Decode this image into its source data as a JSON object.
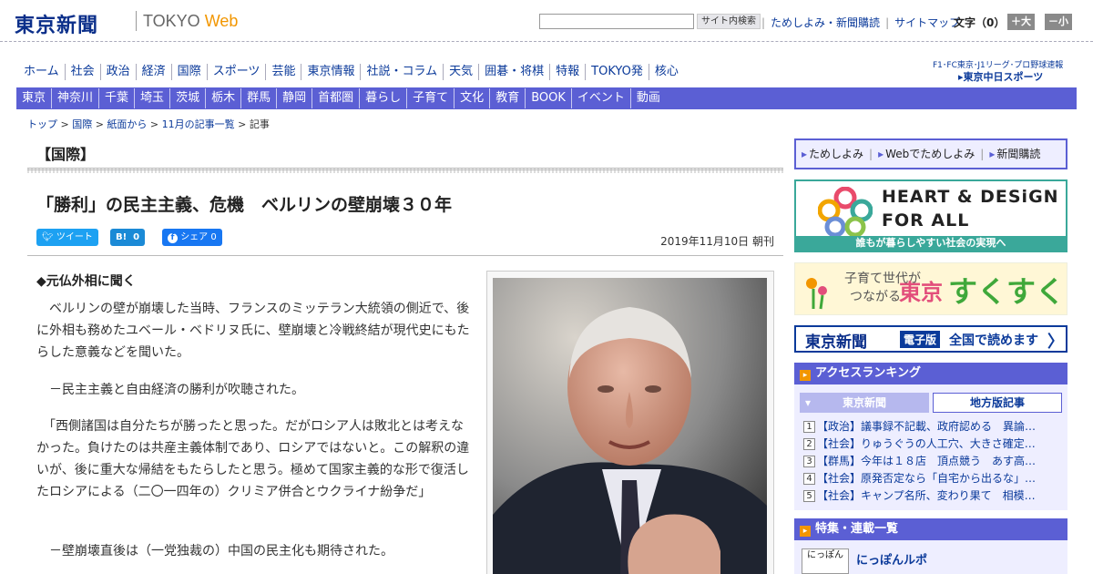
{
  "header": {
    "logo": "東京新聞",
    "logo_sub_a": "TOKYO",
    "logo_sub_b": "Web",
    "search_placeholder": "",
    "search_button": "サイト内検索",
    "links": [
      "ためしよみ・新聞購読",
      "サイトマップ"
    ],
    "font_size_label": "文字（0）",
    "font_up": "＋大",
    "font_down": "－小"
  },
  "nav_main": [
    "ホーム",
    "社会",
    "政治",
    "経済",
    "国際",
    "スポーツ",
    "芸能",
    "東京情報",
    "社説・コラム",
    "天気",
    "囲碁・将棋",
    "特報",
    "TOKYO発",
    "核心"
  ],
  "sports": {
    "line1": "F1･FC東京･J1リーグ･プロ野球速報",
    "line2": "▸東京中日スポーツ"
  },
  "nav_region": [
    "東京",
    "神奈川",
    "千葉",
    "埼玉",
    "茨城",
    "栃木",
    "群馬",
    "静岡",
    "首都圏",
    "暮らし",
    "子育て",
    "文化",
    "教育",
    "BOOK",
    "イベント",
    "動画"
  ],
  "breadcrumb": [
    "トップ",
    "国際",
    "紙面から",
    "11月の記事一覧",
    "記事"
  ],
  "article": {
    "section": "【国際】",
    "headline": "「勝利」の民主主義、危機　ベルリンの壁崩壊３０年",
    "share": {
      "tweet": "ツイート",
      "hatena": "B!",
      "hatena_count": "0",
      "fb": "シェア",
      "fb_count": "0"
    },
    "date": "2019年11月10日 朝刊",
    "subhead": "◆元仏外相に聞く",
    "paragraphs": [
      "　ベルリンの壁が崩壊した当時、フランスのミッテラン大統領の側近で、後に外相も務めたユベール・ベドリヌ氏に、壁崩壊と冷戦終結が現代史にもたらした意義などを聞いた。",
      "　－民主主義と自由経済の勝利が吹聴された。",
      "　「西側諸国は自分たちが勝ったと思った。だがロシア人は敗北とは考えなかった。負けたのは共産主義体制であり、ロシアではないと。この解釈の違いが、後に重大な帰結をもたらしたと思う。極めて国家主義的な形で復活したロシアによる（二〇一四年の）クリミア併合とウクライナ紛争だ」",
      "　－壁崩壊直後は（一党独裁の）中国の民主化も期待された。"
    ]
  },
  "sidebar": {
    "promo_links": [
      "ためしよみ",
      "Webでためしよみ",
      "新聞購読"
    ],
    "heart_line1": "HEART & DESiGN",
    "heart_line2": "FOR ALL",
    "heart_foot": "誰もが暮らしやすい社会の実現へ",
    "suku_line1": "子育て世代が",
    "suku_line2": "つながる",
    "suku_tokyo": "東京",
    "suku_name": "すくすく",
    "ebook_logo": "東京新聞",
    "ebook_tag": "電子版",
    "ebook_text": "全国で読めます",
    "ranking_title": "アクセスランキング",
    "ranking_tab1": "東京新聞",
    "ranking_tab2": "地方版記事",
    "ranking": [
      {
        "n": "1",
        "t": "【政治】議事録不記載、政府認める　異論…"
      },
      {
        "n": "2",
        "t": "【社会】りゅうぐうの人工穴、大きさ確定…"
      },
      {
        "n": "3",
        "t": "【群馬】今年は１８店　頂点競う　あす高…"
      },
      {
        "n": "4",
        "t": "【社会】原発否定なら「自宅から出るな」…"
      },
      {
        "n": "5",
        "t": "【社会】キャンプ名所、変わり果て　相模…"
      }
    ],
    "feature_title": "特集・連載一覧",
    "feature_thumb": "にっぽん",
    "feature_item": "にっぽんルポ"
  },
  "colors": {
    "brand": "#0b2f8a",
    "nav": "#5b5fd4",
    "accent": "#f29600",
    "heart": "#3aa89a"
  }
}
